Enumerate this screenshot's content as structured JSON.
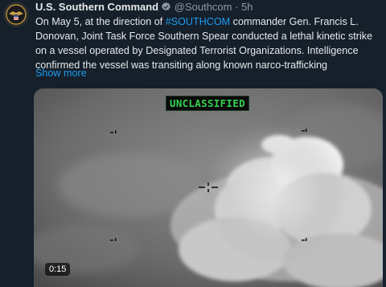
{
  "tweet": {
    "author_name": "U.S. Southern Command",
    "handle": "@Southcom",
    "separator": "·",
    "time": "5h",
    "text_before": "On May 5, at the direction of ",
    "hashtag": "#SOUTHCOM",
    "text_after": " commander Gen. Francis L. Donovan, Joint Task Force Southern Spear conducted a lethal kinetic strike on a vessel operated by Designated Terrorist Organizations. Intelligence confirmed the vessel was transiting along known narco-trafficking",
    "show_more": "Show more",
    "accent_color": "#1d9bf0"
  },
  "media": {
    "overlay_label": "UNCLASSIFIED",
    "overlay_color": "#33d14f",
    "duration": "0:15",
    "icons": [
      "verified-badge-icon",
      "crosshair-icon"
    ]
  }
}
